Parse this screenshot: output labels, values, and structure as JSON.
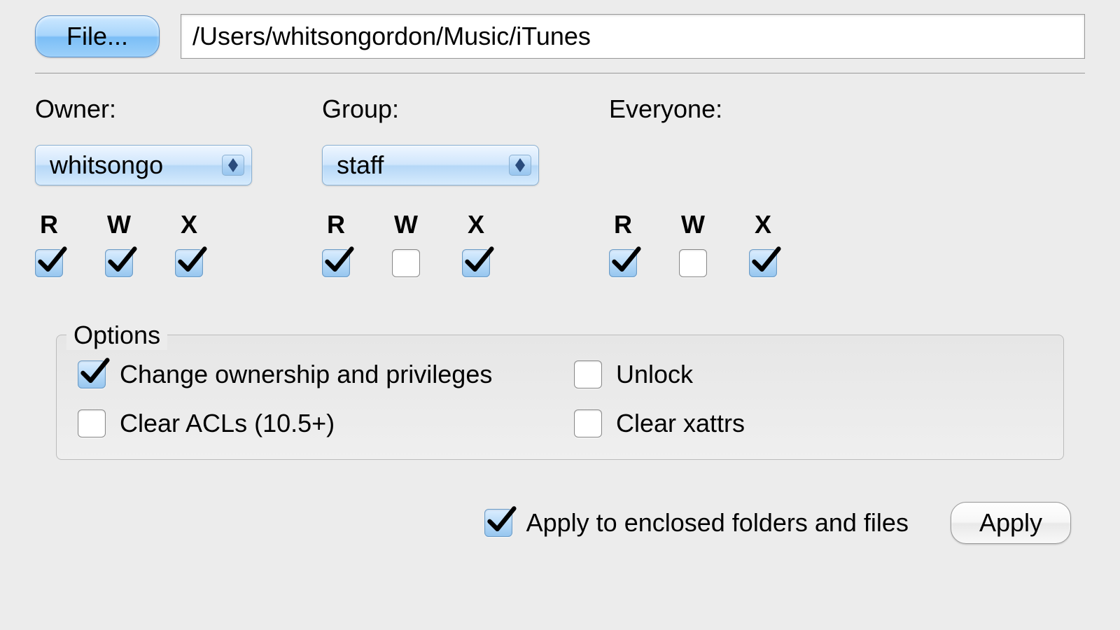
{
  "file_button_label": "File...",
  "file_path": "/Users/whitsongordon/Music/iTunes",
  "columns": {
    "owner": {
      "label": "Owner:",
      "select_value": "whitsongo"
    },
    "group": {
      "label": "Group:",
      "select_value": "staff"
    },
    "everyone": {
      "label": "Everyone:"
    }
  },
  "rwx": {
    "r": "R",
    "w": "W",
    "x": "X"
  },
  "perms": {
    "owner": {
      "r": true,
      "w": true,
      "x": true
    },
    "group": {
      "r": true,
      "w": false,
      "x": true
    },
    "everyone": {
      "r": true,
      "w": false,
      "x": true
    }
  },
  "options": {
    "legend": "Options",
    "change_ownership": {
      "label": "Change ownership and privileges",
      "checked": true
    },
    "unlock": {
      "label": "Unlock",
      "checked": false
    },
    "clear_acls": {
      "label": "Clear ACLs (10.5+)",
      "checked": false
    },
    "clear_xattrs": {
      "label": "Clear xattrs",
      "checked": false
    }
  },
  "apply_enclosed": {
    "label": "Apply to enclosed folders and files",
    "checked": true
  },
  "apply_button_label": "Apply"
}
